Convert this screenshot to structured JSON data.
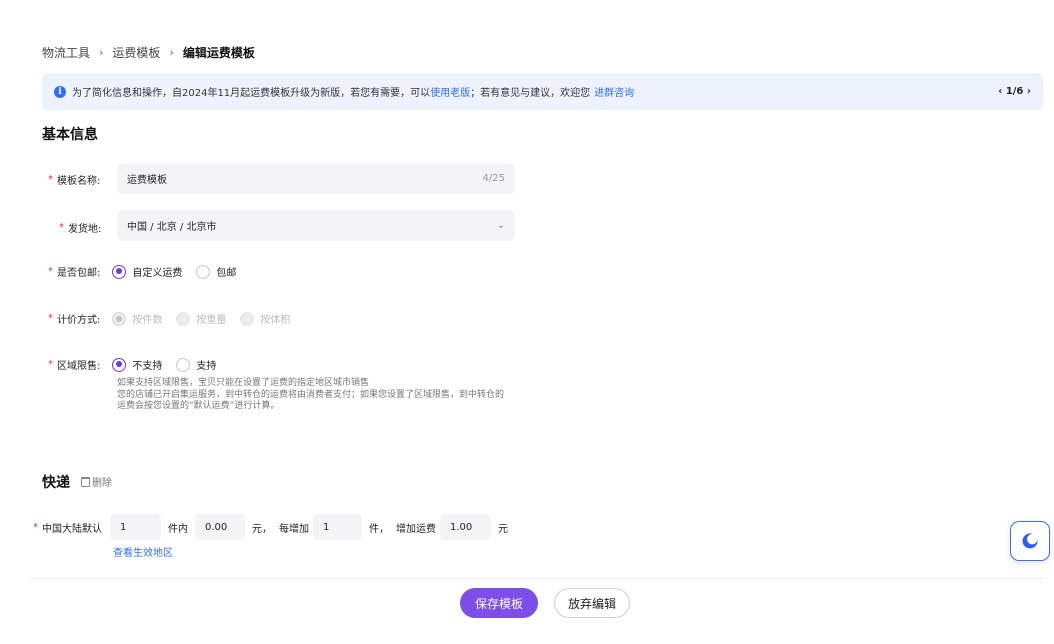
{
  "breadcrumb": {
    "item1": "物流工具",
    "item2": "运费模板",
    "current": "编辑运费模板",
    "sep": "›"
  },
  "notice": {
    "icon": "info-icon",
    "text_before": "为了简化信息和操作，自2024年11月起运费模板升级为新版，若您有需要，可以",
    "link_old": "使用老版",
    "text_middle": "；若有意见与建议，欢迎您 ",
    "link_group": "进群咨询",
    "pager": "‹ 1/6 ›"
  },
  "basic": {
    "title": "基本信息",
    "required_mark": "*",
    "name_label": "模板名称:",
    "name_value": "运费模板",
    "name_counter": "4/25",
    "origin_label": "发货地:",
    "origin_value": "中国 / 北京 / 北京市",
    "free_label": "是否包邮:",
    "free_options": [
      "自定义运费",
      "包邮"
    ],
    "pricing_label": "计价方式:",
    "pricing_options": [
      "按件数",
      "按重量",
      "按体积"
    ],
    "region_label": "区域限售:",
    "region_options": [
      "不支持",
      "支持"
    ],
    "help_lines": [
      "如果支持区域限售，宝贝只能在设置了运费的指定地区城市销售",
      "您的店铺已开启集运服务，到中转仓的运费将由消费者支付；如果您设置了区域限售，到中转仓的",
      "运费会按您设置的“默认运费”进行计算。"
    ]
  },
  "express": {
    "title": "快递",
    "delete_label": "删除",
    "row_label": "中国大陆默认",
    "first_count": "1",
    "unit_inside": "件内",
    "first_fee": "0.00",
    "unit_yuan1": "元，",
    "each_add": "每增加",
    "add_count": "1",
    "unit_piece": "件，",
    "add_fee_label": "增加运费",
    "add_fee": "1.00",
    "unit_yuan2": "元",
    "view_region": "查看生效地区"
  },
  "footer": {
    "save": "保存模板",
    "discard": "放弃编辑"
  },
  "colors": {
    "primary": "#7e4ee8",
    "link": "#2f6ff5",
    "required": "#e0303a"
  }
}
